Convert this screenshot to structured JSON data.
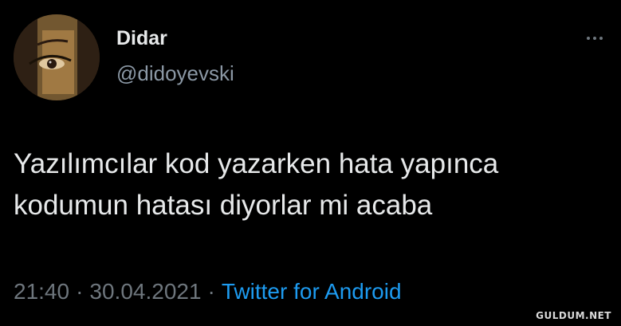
{
  "tweet": {
    "author": {
      "display_name": "Didar",
      "handle": "@didoyevski"
    },
    "text_lines": [
      "Yazılımcılar kod yazarken hata yapınca",
      "kodumun hatası diyorlar mi acaba"
    ],
    "time": "21:40",
    "separator": "·",
    "date": "30.04.2021",
    "source": "Twitter for Android"
  },
  "icons": {
    "more": "more-horizontal-icon",
    "avatar": "profile-photo"
  },
  "watermark": "GULDUM.NET",
  "colors": {
    "background": "#000000",
    "text": "#e7e9ea",
    "secondary": "#8b98a5",
    "link": "#1d9bf0"
  }
}
